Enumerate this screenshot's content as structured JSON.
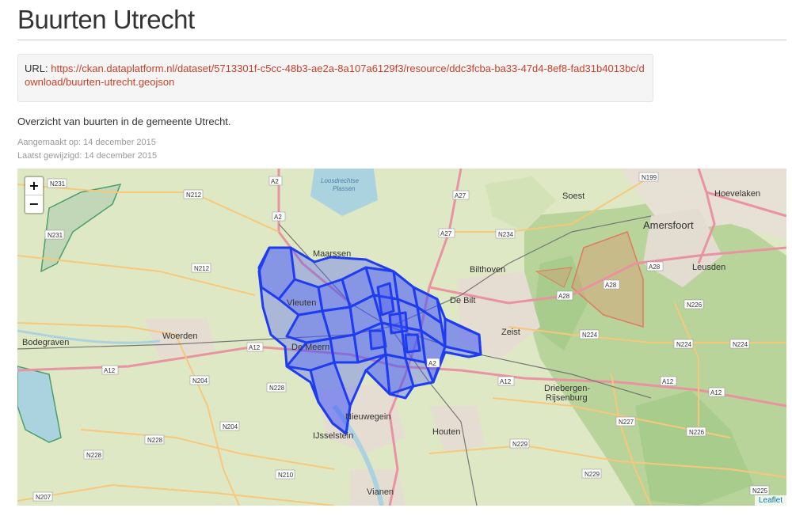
{
  "page": {
    "title": "Buurten Utrecht",
    "url_label": "URL:",
    "url": "https://ckan.dataplatform.nl/dataset/5713301f-c5cc-48b3-ae2a-8a107a6129f3/resource/ddc3fcba-ba33-47d4-8ef8-fad31b4013bc/download/buurten-utrecht.geojson",
    "description": "Overzicht van buurten in de gemeente Utrecht.",
    "created": "Aangemaakt op: 14 december 2015",
    "modified": "Laatst gewijzigd: 14 december 2015"
  },
  "map": {
    "zoom_in": "+",
    "zoom_out": "−",
    "attribution": "Leaflet",
    "places": {
      "maarssen": "Maarssen",
      "vleuten": "Vleuten",
      "de_meern": "De Meern",
      "woerden": "Woerden",
      "bodegraven": "Bodegraven",
      "nieuwegein": "Nieuwegein",
      "ijsselstein": "IJsselstein",
      "houten": "Houten",
      "vianen": "Vianen",
      "bilthoven": "Bilthoven",
      "de_bilt": "De Bilt",
      "zeist": "Zeist",
      "soest": "Soest",
      "amersfoort": "Amersfoort",
      "leusden": "Leusden",
      "hoevelaken": "Hoevelaken",
      "driebergen": "Driebergen-",
      "rijsenburg": "Rijsenburg",
      "loosdrechtse": "Loosdrechtse",
      "plassen": "Plassen"
    },
    "roads": {
      "n231_a": "N231",
      "n231_b": "N231",
      "n212_a": "N212",
      "n212_b": "N212",
      "a2_a": "A2",
      "a2_b": "A2",
      "a2_c": "A2",
      "a27_a": "A27",
      "a27_b": "A27",
      "n234": "N234",
      "n199": "N199",
      "a28_a": "A28",
      "a28_b": "A28",
      "a28_c": "A28",
      "n226_a": "N226",
      "n226_b": "N226",
      "n224_a": "N224",
      "n224_b": "N224",
      "n224_c": "N224",
      "a12_a": "A12",
      "a12_b": "A12",
      "a12_c": "A12",
      "a12_d": "A12",
      "a12_e": "A12",
      "n204_a": "N204",
      "n204_b": "N204",
      "n228_a": "N228",
      "n228_b": "N228",
      "n228_c": "N228",
      "n210": "N210",
      "n207": "N207",
      "n229_a": "N229",
      "n229_b": "N229",
      "n227": "N227",
      "n225": "N225"
    }
  }
}
